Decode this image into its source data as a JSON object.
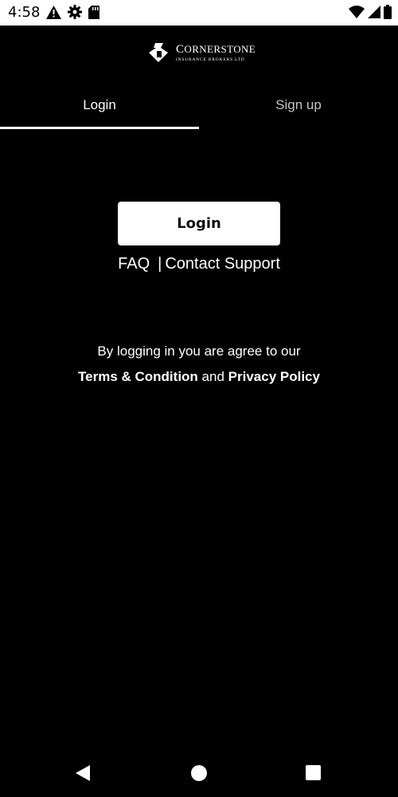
{
  "status_bar": {
    "time": "4:58",
    "left_icons": [
      "warning-icon",
      "settings-icon",
      "sd-card-icon"
    ],
    "right_icons": [
      "wifi-icon",
      "cell-signal-icon",
      "battery-icon"
    ]
  },
  "logo": {
    "name_first_letter": "C",
    "name_rest": "ORNERSTONE",
    "subtitle": "INSURANCE BROKERS LTD"
  },
  "tabs": [
    {
      "label": "Login",
      "active": true
    },
    {
      "label": "Sign up",
      "active": false
    }
  ],
  "login_button": {
    "label": "Login"
  },
  "help_links": {
    "faq": "FAQ",
    "separator": "|",
    "contact": "Contact Support"
  },
  "terms": {
    "line1": "By logging in you are agree to our",
    "terms_link": "Terms & Condition",
    "and": "and",
    "privacy_link": "Privacy Policy"
  },
  "nav_bar": {
    "icons": [
      "back-icon",
      "home-icon",
      "recents-icon"
    ]
  },
  "colors": {
    "background": "#000000",
    "foreground": "#ffffff",
    "inactive_tab": "#c4c4c4",
    "status_bar": "#ffffff"
  }
}
